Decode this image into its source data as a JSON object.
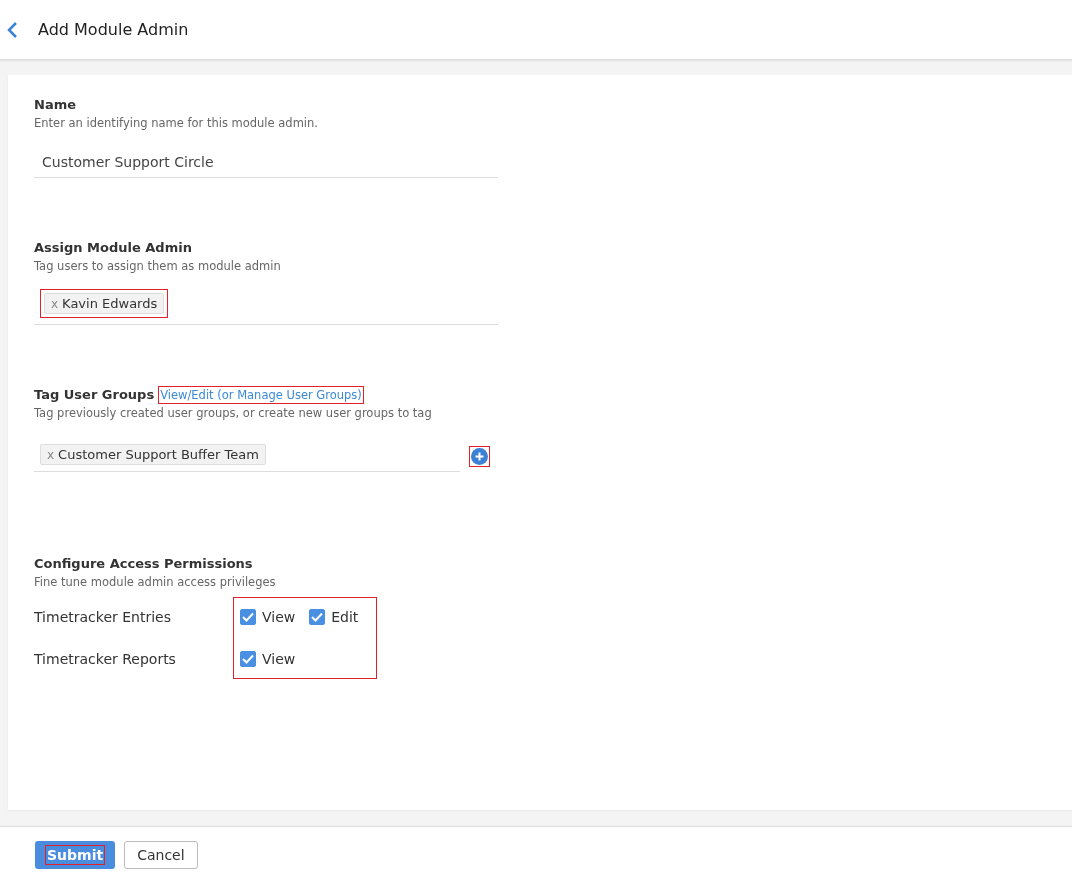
{
  "header": {
    "title": "Add Module Admin"
  },
  "sections": [
    {
      "kind": "text",
      "title": "Name",
      "description": "Enter an identifying name for this module admin.",
      "value": "Customer Support Circle"
    },
    {
      "kind": "tags",
      "title": "Assign Module Admin",
      "description": "Tag users to assign them as module admin",
      "tags": [
        {
          "remove": "x",
          "label": "Kavin Edwards",
          "highlighted": true
        }
      ]
    },
    {
      "kind": "tags",
      "title": "Tag User Groups",
      "link": {
        "label": "View/Edit (or Manage User Groups)",
        "highlighted": true
      },
      "description": "Tag previously created user groups, or create new user groups to tag",
      "tags": [
        {
          "remove": "x",
          "label": "Customer Support Buffer Team"
        }
      ],
      "add_button": {
        "highlighted": true
      }
    },
    {
      "kind": "permissions",
      "title": "Configure Access Permissions",
      "description": "Fine tune module admin access privileges",
      "highlighted": true,
      "rows": [
        {
          "label": "Timetracker Entries",
          "options": [
            {
              "label": "View",
              "checked": true
            },
            {
              "label": "Edit",
              "checked": true
            }
          ]
        },
        {
          "label": "Timetracker Reports",
          "options": [
            {
              "label": "View",
              "checked": true
            }
          ]
        }
      ]
    }
  ],
  "footer": {
    "submit": {
      "label": "Submit",
      "highlighted": true
    },
    "cancel": {
      "label": "Cancel"
    }
  }
}
